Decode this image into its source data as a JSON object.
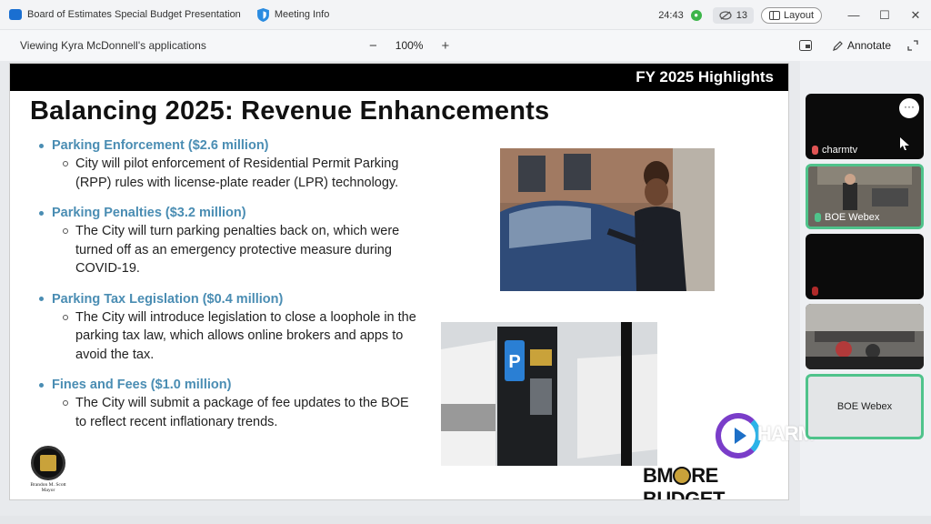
{
  "window": {
    "title": "Board of Estimates Special Budget Presentation",
    "meeting_info": "Meeting Info",
    "timer": "24:43",
    "participant_count": "13",
    "layout_label": "Layout",
    "controls": {
      "minimize": "—",
      "maximize": "☐",
      "close": "✕"
    }
  },
  "share_bar": {
    "viewing_text": "Viewing Kyra McDonnell's applications",
    "zoom_out": "−",
    "zoom_level": "100%",
    "zoom_in": "+",
    "annotate_label": "Annotate"
  },
  "slide": {
    "header": "FY 2025 Highlights",
    "title": "Balancing 2025: Revenue Enhancements",
    "items": [
      {
        "heading": "Parking Enforcement ($2.6 million)",
        "body": "City will pilot enforcement of Residential Permit Parking (RPP) rules with license-plate reader (LPR) technology."
      },
      {
        "heading": "Parking Penalties ($3.2 million)",
        "body": "The City will turn parking penalties back on, which were turned off as an emergency protective measure during COVID-19."
      },
      {
        "heading": "Parking Tax Legislation ($0.4 million)",
        "body": "The City will introduce legislation to close a loophole in the parking tax law, which allows online brokers and apps to avoid the tax."
      },
      {
        "heading": "Fines and Fees ($1.0 million)",
        "body": "The City will submit a package of fee updates to the BOE to reflect recent inflationary trends."
      }
    ],
    "seal_name": "Brandon M. Scott",
    "seal_title": "Mayor",
    "brand_left": "BM",
    "brand_right": "RE BUDGET",
    "charm_logo_text": "HARM"
  },
  "participants": [
    {
      "name": "charmtv",
      "more": "···"
    },
    {
      "name": "BOE Webex"
    },
    {
      "name": ""
    },
    {
      "name": ""
    },
    {
      "name": "BOE Webex"
    }
  ],
  "colors": {
    "accent_blue": "#4a8db3",
    "selected_tile": "#4fc38b",
    "title_bar": "#f3f4f6"
  }
}
